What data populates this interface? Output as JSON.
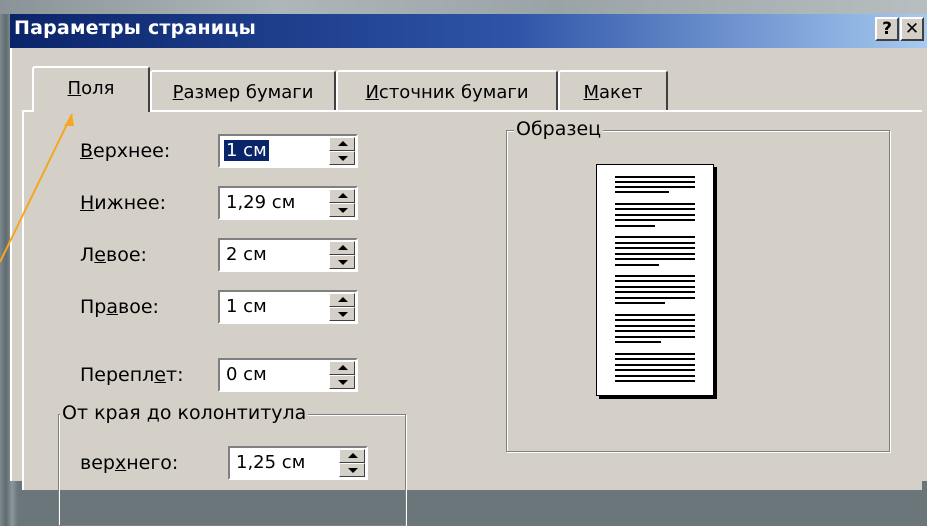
{
  "dialog": {
    "title": "Параметры страницы",
    "help_button": "?",
    "close_button": "✕",
    "tabs": [
      {
        "pre": "",
        "key": "П",
        "post": "оля",
        "active": true
      },
      {
        "pre": "",
        "key": "Р",
        "post": "азмер бумаги",
        "active": false
      },
      {
        "pre": "",
        "key": "И",
        "post": "сточник бумаги",
        "active": false
      },
      {
        "pre": "",
        "key": "М",
        "post": "акет",
        "active": false
      }
    ],
    "margins": [
      {
        "pre": "",
        "key": "В",
        "post": "ерхнее:",
        "value": "1 см",
        "selected": true
      },
      {
        "pre": "",
        "key": "Н",
        "post": "ижнее:",
        "value": "1,29 см",
        "selected": false
      },
      {
        "pre": "Л",
        "key": "е",
        "post": "вое:",
        "value": "2 см",
        "selected": false
      },
      {
        "pre": "Пр",
        "key": "а",
        "post": "вое:",
        "value": "1 см",
        "selected": false
      }
    ],
    "gutter": {
      "pre": "Перепл",
      "key": "е",
      "post": "т:",
      "value": "0 см"
    },
    "header_footer_group": {
      "legend": "От края до колонтитула",
      "header": {
        "pre": "вер",
        "key": "х",
        "post": "него:",
        "value": "1,25 см"
      }
    },
    "preview": {
      "legend": "Образец"
    }
  },
  "colors": {
    "titlebar_start": "#0a246a",
    "titlebar_end": "#a6caf0",
    "face": "#d4d0c8",
    "arrow": "#f5a623"
  }
}
